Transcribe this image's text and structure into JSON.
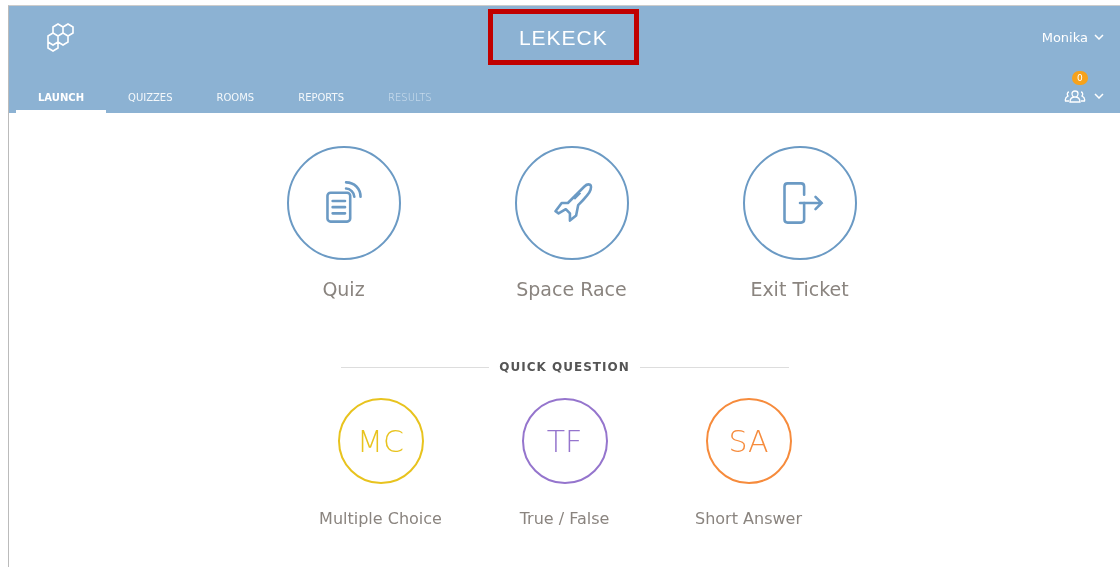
{
  "header": {
    "title": {
      "text": "LEKECK",
      "highlighted": true
    },
    "user": "Monika",
    "rooms_badge": "0"
  },
  "tabs": [
    {
      "label": "LAUNCH",
      "selected": true,
      "disabled": false
    },
    {
      "label": "QUIZZES",
      "selected": false,
      "disabled": false
    },
    {
      "label": "ROOMS",
      "selected": false,
      "disabled": false
    },
    {
      "label": "REPORTS",
      "selected": false,
      "disabled": false
    },
    {
      "label": "RESULTS",
      "selected": false,
      "disabled": true
    }
  ],
  "launch_options": [
    {
      "kind": "quiz",
      "label": "Quiz"
    },
    {
      "kind": "race",
      "label": "Space Race"
    },
    {
      "kind": "exit",
      "label": "Exit Ticket"
    }
  ],
  "quick_question": {
    "heading": "QUICK QUESTION",
    "options": [
      {
        "abbr": "MC",
        "label": "Multiple Choice",
        "color": "#e8c31e"
      },
      {
        "abbr": "TF",
        "label": "True / False",
        "color": "#9575cd"
      },
      {
        "abbr": "SA",
        "label": "Short Answer",
        "color": "#f68b3c"
      }
    ]
  }
}
